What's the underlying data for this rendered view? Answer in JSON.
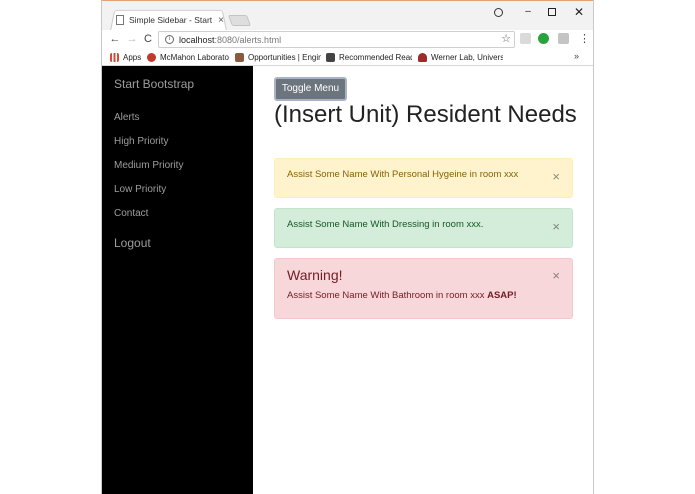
{
  "browser": {
    "tab_title": "Simple Sidebar - Start Bo",
    "tab_close": "×",
    "url_host": "localhost",
    "url_path": ":8080/alerts.html",
    "back": "←",
    "forward": "→",
    "reload": "C",
    "star": "☆",
    "menu": "⋮",
    "min": "–",
    "close": "✕",
    "bookmarks_more": "»",
    "bookmarks": [
      {
        "label": "Apps",
        "icon": "apps-icon"
      },
      {
        "label": "McMahon Laborator",
        "icon": "mcmahon-icon"
      },
      {
        "label": "Opportunities | Engin",
        "icon": "opportunities-icon"
      },
      {
        "label": "Recommended Readi",
        "icon": "recommended-icon"
      },
      {
        "label": "Werner Lab, Univers",
        "icon": "werner-icon"
      }
    ]
  },
  "sidebar": {
    "brand": "Start Bootstrap",
    "links": [
      "Alerts",
      "High Priority",
      "Medium Priority",
      "Low Priority",
      "Contact"
    ],
    "logout": "Logout"
  },
  "main": {
    "toggle_label": "Toggle Menu",
    "title": "(Insert Unit) Resident Needs",
    "alerts": [
      {
        "type": "warning",
        "text": "Assist Some Name With Personal Hygeine in room xxx",
        "close": "×",
        "color": "#856404"
      },
      {
        "type": "success",
        "text": "Assist Some Name With Dressing in room xxx.",
        "close": "×",
        "color": "#155724"
      },
      {
        "type": "danger",
        "heading": "Warning!",
        "text": "Assist Some Name With Bathroom in room xxx ",
        "emphasis": "ASAP!",
        "close": "×",
        "color": "#721c24"
      }
    ]
  }
}
